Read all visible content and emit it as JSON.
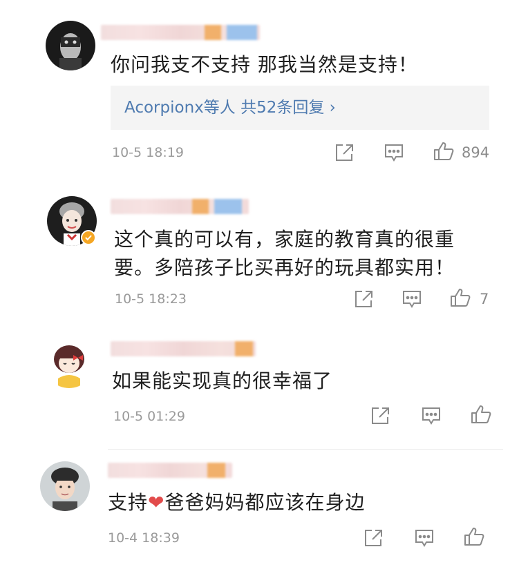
{
  "comments": [
    {
      "text": "你问我支不支持 那我当然是支持！",
      "reply": {
        "prefix": "Acorpionx等人 ",
        "count_label": "共52条回复 ›"
      },
      "time": "10-5 18:19",
      "likes": "894"
    },
    {
      "text_line1": "这个真的可以有，家庭的教育真的很重",
      "text_line2": "要。多陪孩子比买再好的玩具都实用！",
      "time": "10-5 18:23",
      "likes": "7"
    },
    {
      "text": "如果能实现真的很幸福了",
      "time": "10-5 01:29",
      "likes": ""
    },
    {
      "text_before": "支持",
      "heart": "❤",
      "text_after": "爸爸妈妈都应该在身边",
      "time": "10-4 18:39",
      "likes": ""
    }
  ],
  "icons": {
    "share": "share-icon",
    "comment": "comment-icon",
    "like": "thumbs-up-icon",
    "verified": "verified-badge-icon"
  },
  "colors": {
    "link": "#4f7bb0",
    "heart": "#e24b4b",
    "verified": "#f5a623"
  }
}
